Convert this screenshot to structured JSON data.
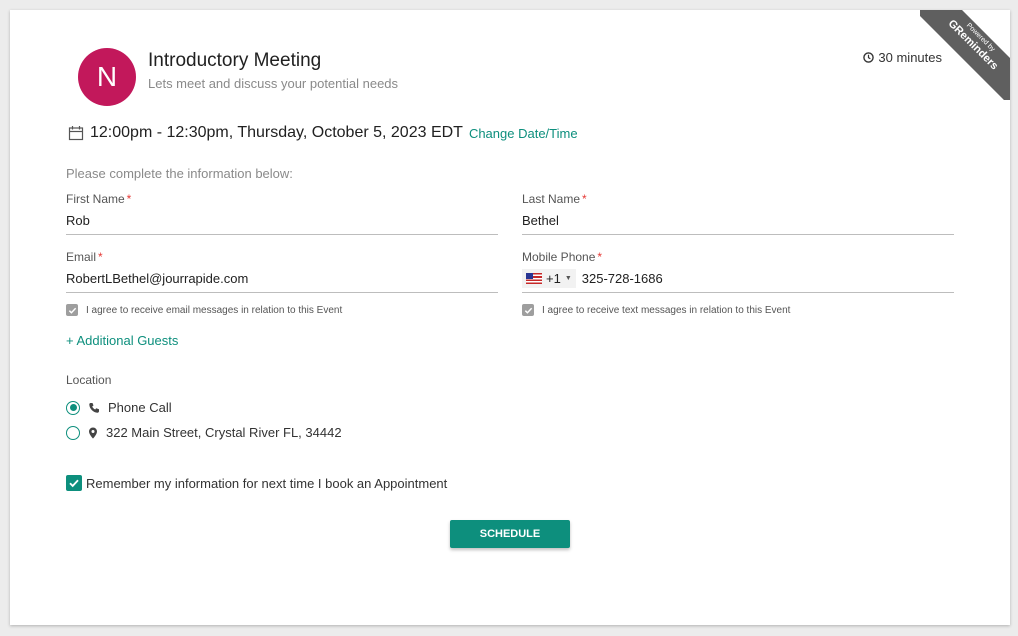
{
  "ribbon": {
    "line1": "Powered by",
    "line2": "GReminders"
  },
  "header": {
    "avatar_letter": "N",
    "title": "Introductory Meeting",
    "subtitle": "Lets meet and discuss your potential needs",
    "duration": "30 minutes"
  },
  "datetime": {
    "text": "12:00pm - 12:30pm, Thursday, October 5, 2023 EDT",
    "change_label": "Change Date/Time"
  },
  "form": {
    "instructions": "Please complete the information below:",
    "required_marker": "*",
    "first_name": {
      "label": "First Name",
      "value": "Rob"
    },
    "last_name": {
      "label": "Last Name",
      "value": "Bethel"
    },
    "email": {
      "label": "Email",
      "value": "RobertLBethel@jourrapide.com",
      "consent": "I agree to receive email messages in relation to this Event"
    },
    "phone": {
      "label": "Mobile Phone",
      "country_code": "+1",
      "value": "325-728-1686",
      "consent": "I agree to receive text messages in relation to this Event"
    },
    "additional_guests": "+ Additional Guests"
  },
  "location": {
    "label": "Location",
    "options": [
      {
        "label": "Phone Call",
        "selected": true
      },
      {
        "label": "322 Main Street, Crystal River FL, 34442",
        "selected": false
      }
    ]
  },
  "remember_label": "Remember my information for next time I book an Appointment",
  "schedule_label": "SCHEDULE",
  "colors": {
    "accent": "#0d8f7d",
    "avatar": "#c2185b",
    "required": "#e53935"
  }
}
